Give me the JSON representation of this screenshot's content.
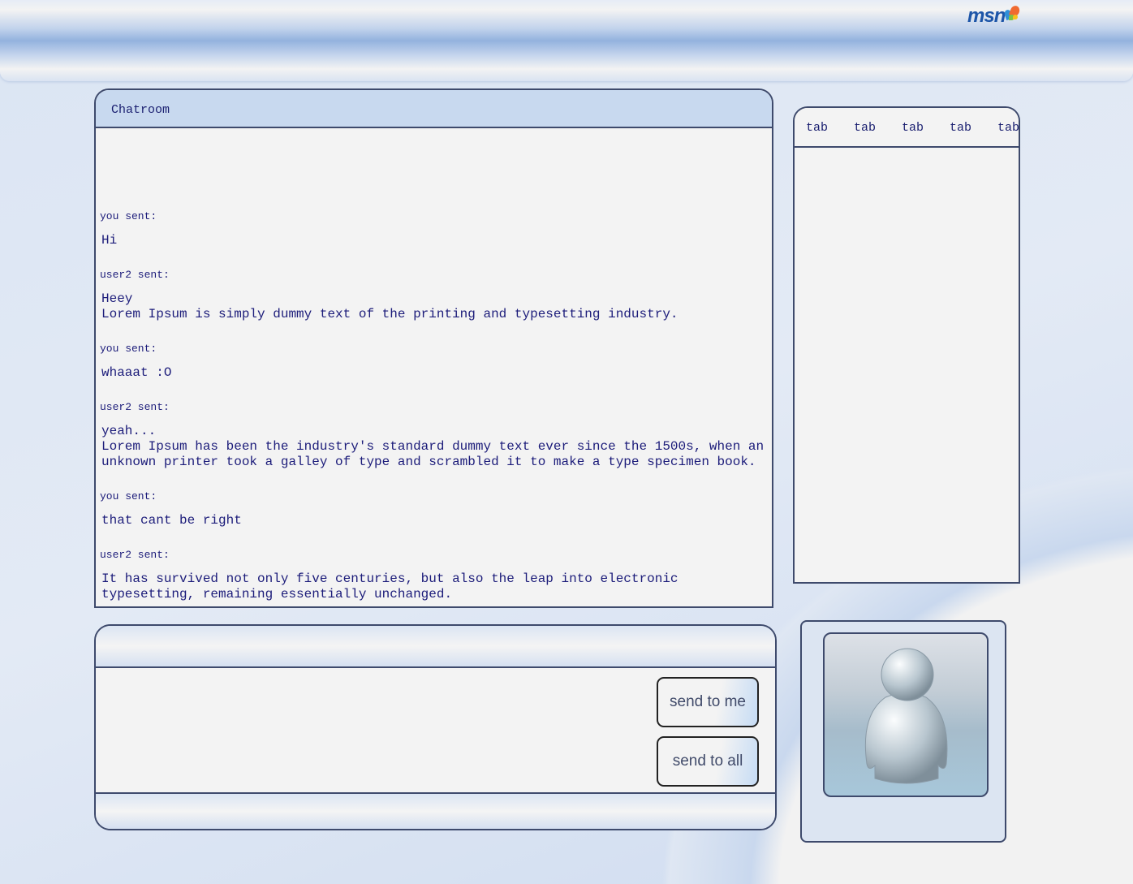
{
  "header": {
    "logo": "msn"
  },
  "chatroom": {
    "title": "Chatroom",
    "messages": [
      {
        "sender": "you sent:",
        "text": "Hi"
      },
      {
        "sender": "user2 sent:",
        "text": "Heey\nLorem Ipsum is simply dummy text of the printing and typesetting industry."
      },
      {
        "sender": "you sent:",
        "text": "whaaat :O"
      },
      {
        "sender": "user2 sent:",
        "text": "yeah...\nLorem Ipsum has been the industry's standard dummy text ever since the 1500s, when an\nunknown printer took a galley of type and scrambled it to make a type specimen book."
      },
      {
        "sender": "you sent:",
        "text": "that cant be right"
      },
      {
        "sender": "user2 sent:",
        "text": "It has survived not only five centuries, but also the leap into electronic\ntypesetting, remaining essentially unchanged."
      }
    ]
  },
  "tabs": [
    "tab",
    "tab",
    "tab",
    "tab",
    "tab"
  ],
  "compose": {
    "send_to_me": "send to me",
    "send_to_all": "send to all"
  }
}
